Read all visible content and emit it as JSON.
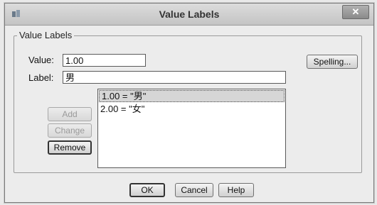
{
  "window": {
    "title": "Value Labels",
    "close_label": "✕"
  },
  "group": {
    "legend": "Value Labels"
  },
  "value": {
    "label": "Value:",
    "current": "1.00"
  },
  "label": {
    "label": "Label:",
    "current": "男"
  },
  "buttons": {
    "spelling": "Spelling...",
    "add": "Add",
    "change": "Change",
    "remove": "Remove",
    "ok": "OK",
    "cancel": "Cancel",
    "help": "Help"
  },
  "list": {
    "items": [
      "1.00 = \"男\"",
      "2.00 = \"女\""
    ],
    "selected_index": 0
  }
}
